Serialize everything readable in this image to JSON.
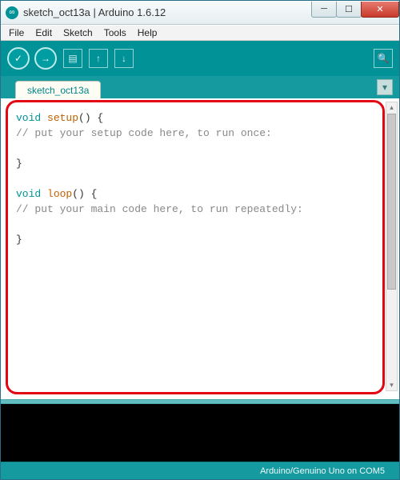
{
  "window": {
    "title": "sketch_oct13a | Arduino 1.6.12",
    "app_icon_glyph": "∞"
  },
  "window_controls": {
    "minimize": "─",
    "maximize": "☐",
    "close": "✕"
  },
  "menubar": {
    "items": [
      "File",
      "Edit",
      "Sketch",
      "Tools",
      "Help"
    ]
  },
  "toolbar": {
    "verify_glyph": "✓",
    "upload_glyph": "→",
    "new_glyph": "▤",
    "open_glyph": "↑",
    "save_glyph": "↓",
    "serial_glyph": "🔍"
  },
  "tabs": {
    "active": "sketch_oct13a",
    "dropdown_glyph": "▾"
  },
  "code": {
    "l1_kw": "void ",
    "l1_fn": "setup",
    "l1_rest": "() {",
    "l2": "  // put your setup code here, to run once:",
    "l3": "",
    "l4": "}",
    "l5": "",
    "l6_kw": "void ",
    "l6_fn": "loop",
    "l6_rest": "() {",
    "l7": "  // put your main code here, to run repeatedly:",
    "l8": "",
    "l9": "}"
  },
  "status": {
    "board": "Arduino/Genuino Uno on COM5"
  },
  "scrollbar": {
    "up": "▴",
    "down": "▾"
  }
}
